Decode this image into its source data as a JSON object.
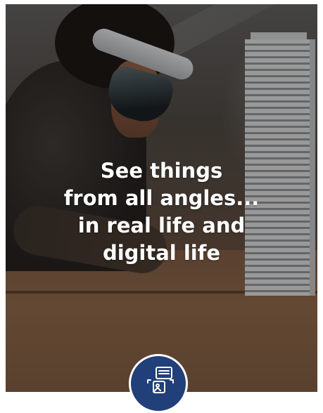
{
  "hero": {
    "headline_lines": [
      "See things",
      "from all angles...",
      "in real life and",
      "digital life"
    ]
  },
  "badge": {
    "icon": "devices-share-icon",
    "color": "#213f78"
  }
}
